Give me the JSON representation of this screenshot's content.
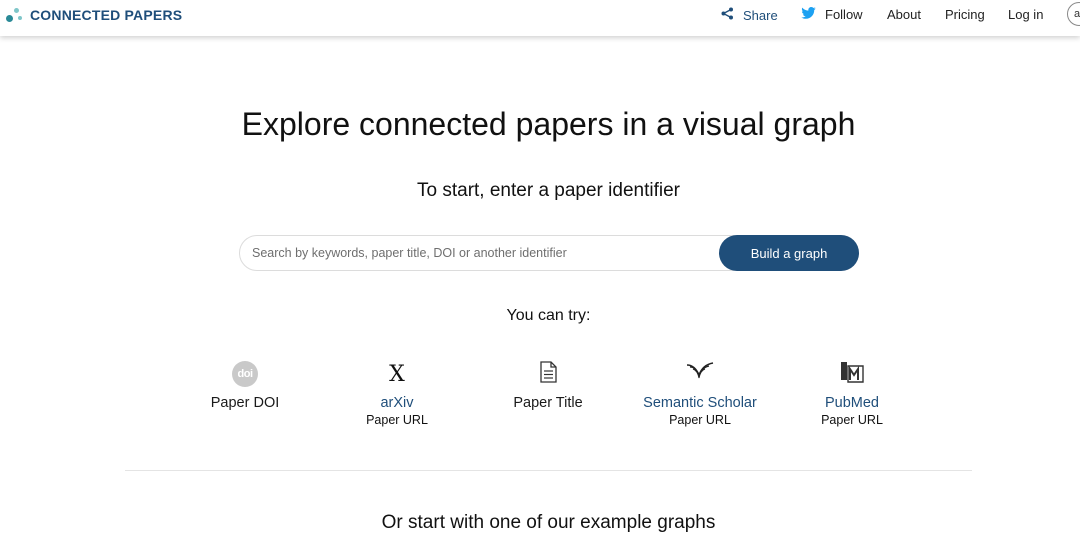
{
  "header": {
    "brand": "CONNECTED PAPERS",
    "nav": {
      "share": "Share",
      "follow": "Follow",
      "about": "About",
      "pricing": "Pricing",
      "login": "Log in"
    },
    "avatar_letter": "a"
  },
  "main": {
    "title": "Explore connected papers in a visual graph",
    "subtitle": "To start, enter a paper identifier",
    "search": {
      "placeholder": "Search by keywords, paper title, DOI or another identifier",
      "value": "",
      "button": "Build a graph"
    },
    "try_label": "You can try:",
    "options": [
      {
        "icon": "doi-icon",
        "title": "Paper DOI",
        "sub": ""
      },
      {
        "icon": "arxiv-icon",
        "title": "arXiv",
        "sub": "Paper URL"
      },
      {
        "icon": "document-icon",
        "title": "Paper Title",
        "sub": ""
      },
      {
        "icon": "semantic-scholar-icon",
        "title": "Semantic Scholar",
        "sub": "Paper URL"
      },
      {
        "icon": "pubmed-icon",
        "title": "PubMed",
        "sub": "Paper URL"
      }
    ],
    "doi_badge_text": "doi",
    "arxiv_glyph": "X",
    "examples_label": "Or start with one of our example graphs"
  },
  "colors": {
    "brand": "#1f4e7a",
    "button_bg": "#1f4e7a",
    "link": "#1f4e7a",
    "twitter": "#1da1f2"
  }
}
